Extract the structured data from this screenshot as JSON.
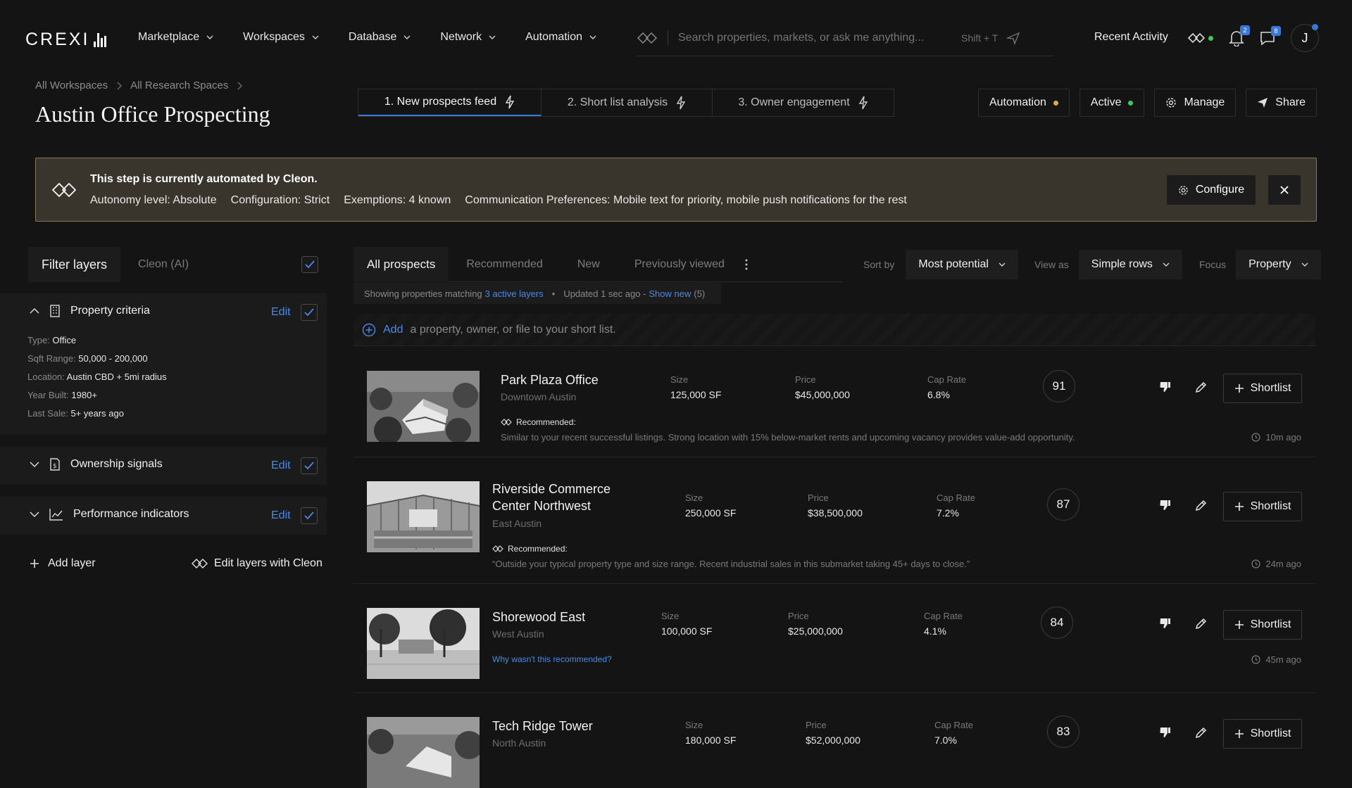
{
  "app": {
    "logo": "CREXI"
  },
  "nav": {
    "items": [
      "Marketplace",
      "Workspaces",
      "Database",
      "Network",
      "Automation"
    ],
    "search_placeholder": "Search properties, markets, or ask me anything...",
    "search_hint": "Shift + T",
    "recent_activity": "Recent Activity",
    "notifications_count": "2",
    "messages_count": "8",
    "avatar_initial": "J"
  },
  "header": {
    "breadcrumbs": [
      "All Workspaces",
      "All Research Spaces"
    ],
    "title": "Austin Office Prospecting",
    "steps": [
      "1. New prospects feed",
      "2. Short list analysis",
      "3. Owner engagement"
    ],
    "automation_label": "Automation",
    "active_label": "Active",
    "manage_label": "Manage",
    "share_label": "Share",
    "colors": {
      "automation_dot": "#e0a94a",
      "active_dot": "#3ec95a",
      "accent": "#3a78d8"
    }
  },
  "banner": {
    "title": "This step is currently automated by Cleon.",
    "autonomy": "Autonomy level: Absolute",
    "configuration": "Configuration: Strict",
    "exemptions": "Exemptions: 4 known",
    "communication": "Communication Preferences: Mobile text for priority, mobile push notifications for the rest",
    "configure_label": "Configure"
  },
  "filters": {
    "tab_active": "Filter layers",
    "tab_other": "Cleon (AI)",
    "edit_label": "Edit",
    "sections": [
      "Property criteria",
      "Ownership signals",
      "Performance indicators"
    ],
    "criteria": [
      {
        "label": "Type:",
        "value": "Office"
      },
      {
        "label": "Sqft Range:",
        "value": "50,000 - 200,000"
      },
      {
        "label": "Location:",
        "value": "Austin CBD + 5mi radius"
      },
      {
        "label": "Year Built:",
        "value": "1980+"
      },
      {
        "label": "Last Sale:",
        "value": "5+ years ago"
      }
    ],
    "add_layer": "Add layer",
    "edit_with_cleon": "Edit layers with Cleon"
  },
  "list": {
    "tabs": [
      "All prospects",
      "Recommended",
      "New",
      "Previously viewed"
    ],
    "sort_label": "Sort by",
    "sort_value": "Most potential",
    "view_label": "View as",
    "view_value": "Simple rows",
    "focus_label": "Focus",
    "focus_value": "Property",
    "info_prefix": "Showing properties matching",
    "info_link": "3 active layers",
    "info_sep": "•",
    "info_updated": "Updated 1 sec ago -",
    "info_show_new": "Show new",
    "info_count": "(5)",
    "add_link": "Add",
    "add_text": "a property, owner, or file to your short list.",
    "labels": {
      "size": "Size",
      "price": "Price",
      "cap": "Cap Rate",
      "recommended": "Recommended:",
      "shortlist": "Shortlist"
    },
    "rows": [
      {
        "name": "Park Plaza Office",
        "location": "Downtown Austin",
        "size": "125,000 SF",
        "price": "$45,000,000",
        "cap": "6.8%",
        "score": "91",
        "note": "Similar to your recent successful listings. Strong location with 15% below-market rents and upcoming vacancy provides value-add opportunity.",
        "time": "10m ago"
      },
      {
        "name": "Riverside Commerce Center Northwest",
        "location": "East Austin",
        "size": "250,000 SF",
        "price": "$38,500,000",
        "cap": "7.2%",
        "score": "87",
        "note": "“Outside your typical property type and size range. Recent industrial sales in this submarket taking 45+ days to close.”",
        "time": "24m ago"
      },
      {
        "name": "Shorewood East",
        "location": "West Austin",
        "size": "100,000 SF",
        "price": "$25,000,000",
        "cap": "4.1%",
        "score": "84",
        "why": "Why wasn't this recommended?",
        "time": "45m ago"
      },
      {
        "name": "Tech Ridge Tower",
        "location": "North Austin",
        "size": "180,000 SF",
        "price": "$52,000,000",
        "cap": "7.0%",
        "score": "83"
      }
    ]
  }
}
